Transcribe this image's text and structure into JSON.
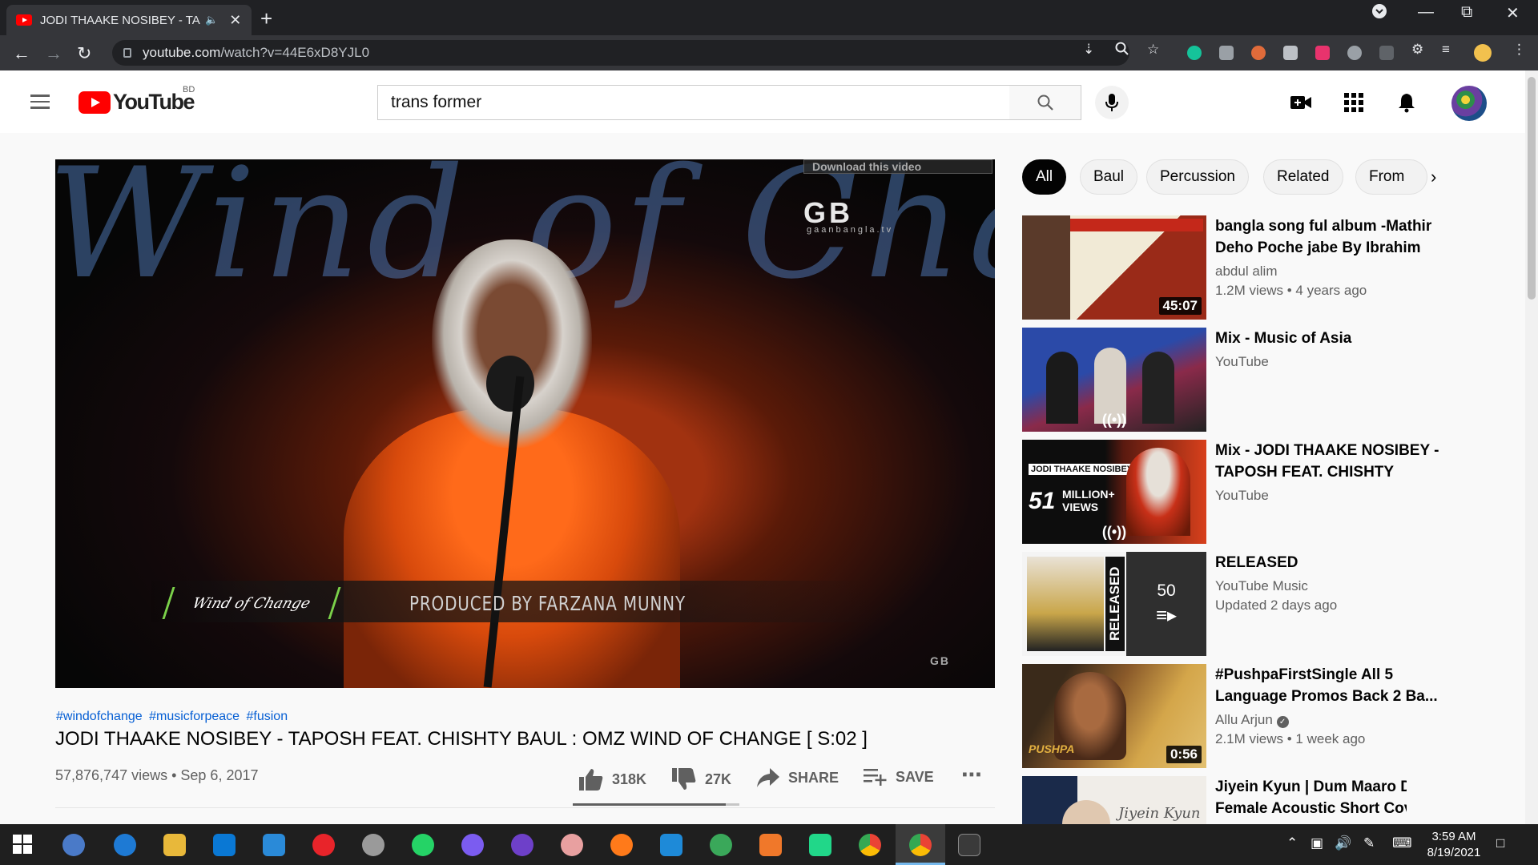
{
  "browser": {
    "tab_title": "JODI THAAKE NOSIBEY - TAP",
    "audio_icon": "speaker-icon",
    "url_host": "youtube.com",
    "url_path": "/watch?v=44E6xD8YJL0"
  },
  "masthead": {
    "logo_text": "YouTube",
    "country_code": "BD",
    "search_value": "trans former"
  },
  "player": {
    "watermark_script": "Wind of Change",
    "download_label": "Download this video",
    "channel_logo": "GB",
    "channel_logo_sub": "gaanbangla.tv",
    "badge_text": "Wind of Change",
    "lower_third": "PRODUCED BY   FARZANA MUNNY",
    "corner_logo": "GB"
  },
  "video": {
    "hashtags": [
      "#windofchange",
      "#musicforpeace",
      "#fusion"
    ],
    "title": "JODI THAAKE NOSIBEY - TAPOSH FEAT. CHISHTY BAUL : OMZ WIND OF CHANGE [ S:02 ]",
    "views_date": "57,876,747 views • Sep 6, 2017",
    "like_count": "318K",
    "dislike_count": "27K",
    "share_label": "SHARE",
    "save_label": "SAVE",
    "like_ratio": 0.92
  },
  "chips": [
    "All",
    "Baul",
    "Percussion",
    "Related",
    "From"
  ],
  "recommendations": [
    {
      "title": "bangla song ful album -Mathir Deho Poche jabe By Ibrahim",
      "channel": "abdul alim",
      "stats": "1.2M views • 4 years ago",
      "duration": "45:07",
      "thumb_colors": [
        "#e9e4d2",
        "#7a1d12"
      ]
    },
    {
      "title": "Mix - Music of Asia",
      "channel": "YouTube",
      "stats": "",
      "duration": "",
      "thumb_colors": [
        "#2b4aa8",
        "#c03a3a"
      ]
    },
    {
      "title": "Mix - JODI THAAKE NOSIBEY - TAPOSH FEAT. CHISHTY BAU...",
      "channel": "YouTube",
      "stats": "",
      "duration": "",
      "thumb_colors": [
        "#101010",
        "#c83018"
      ]
    },
    {
      "title": "RELEASED",
      "channel": "YouTube Music",
      "stats": "Updated 2 days ago",
      "playlist_count": "50",
      "thumb_colors": [
        "#f4f4f4",
        "#2a2a2a"
      ]
    },
    {
      "title": "#PushpaFirstSingle All 5 Language Promos Back 2 Ba...",
      "channel": "Allu Arjun",
      "stats": "2.1M views • 1 week ago",
      "duration": "0:56",
      "thumb_colors": [
        "#6b4a2a",
        "#d4a64a"
      ]
    },
    {
      "title": "Jiyein Kyun | Dum Maaro Dum | Female Acoustic Short Cover...",
      "channel": "",
      "stats": "",
      "duration": "",
      "thumb_colors": [
        "#1a2a4a",
        "#f0ede8"
      ]
    }
  ],
  "taskbar": {
    "time": "3:59 AM",
    "date": "8/19/2021"
  },
  "colors": {
    "youtube_red": "#ff0000",
    "link_blue": "#065fd4",
    "chrome_dark": "#35363a"
  }
}
